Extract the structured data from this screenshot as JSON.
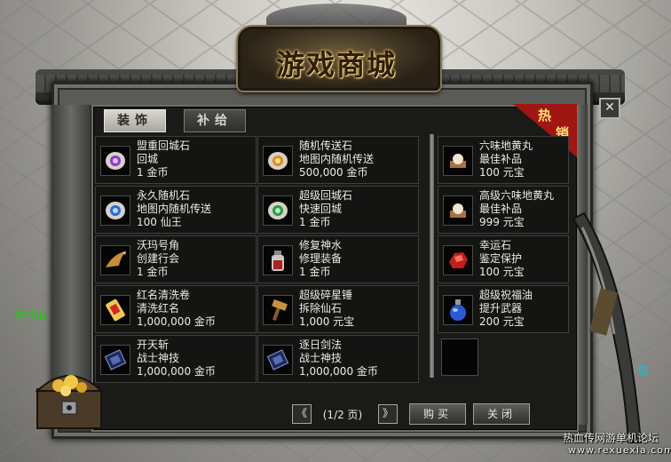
{
  "window": {
    "title": "游戏商城",
    "close_glyph": "✕"
  },
  "tabs": [
    {
      "label": "装饰",
      "active": true
    },
    {
      "label": "补给",
      "active": false
    }
  ],
  "hot_badge": {
    "char1": "热",
    "char2": "销"
  },
  "items_left": [
    {
      "name": "盟重回城石",
      "desc": "回城",
      "price": "1 金币",
      "icon": "purple-scroll-icon"
    },
    {
      "name": "永久随机石",
      "desc": "地图内随机传送",
      "price": "100 仙王",
      "icon": "blue-scroll-icon"
    },
    {
      "name": "沃玛号角",
      "desc": "创建行会",
      "price": "1 金币",
      "icon": "horn-icon"
    },
    {
      "name": "红名清洗卷",
      "desc": "清洗红名",
      "price": "1,000,000 金币",
      "icon": "red-scroll-icon"
    },
    {
      "name": "开天斩",
      "desc": "战士神技",
      "price": "1,000,000 金币",
      "icon": "skill-book-icon"
    }
  ],
  "items_mid": [
    {
      "name": "随机传送石",
      "desc": "地图内随机传送",
      "price": "500,000 金币",
      "icon": "orange-scroll-icon"
    },
    {
      "name": "超级回城石",
      "desc": "快速回城",
      "price": "1 金币",
      "icon": "green-scroll-icon"
    },
    {
      "name": "修复神水",
      "desc": "修理装备",
      "price": "1 金币",
      "icon": "potion-bottle-icon"
    },
    {
      "name": "超级碎星锤",
      "desc": "拆除仙石",
      "price": "1,000 元宝",
      "icon": "hammer-icon"
    },
    {
      "name": "逐日剑法",
      "desc": "战士神技",
      "price": "1,000,000 金币",
      "icon": "skill-book-icon"
    }
  ],
  "items_right": [
    {
      "name": "六味地黄丸",
      "desc": "最佳补品",
      "price": "100 元宝",
      "icon": "pill-box-icon"
    },
    {
      "name": "高级六味地黄丸",
      "desc": "最佳补品",
      "price": "999 元宝",
      "icon": "pill-box-icon"
    },
    {
      "name": "幸运石",
      "desc": "鉴定保护",
      "price": "100 元宝",
      "icon": "red-stone-icon"
    },
    {
      "name": "超级祝福油",
      "desc": "提升武器",
      "price": "200 元宝",
      "icon": "blue-flask-icon"
    }
  ],
  "pager": {
    "prev": "《",
    "label": "(1/2 页)",
    "next": "》"
  },
  "buttons": {
    "buy": "购买",
    "close": "关闭"
  },
  "side": {
    "left_label": "方寸山",
    "right_label": "包"
  },
  "watermark": {
    "line1": "热血传网游单机论坛",
    "line2": "www.rexuexia.com"
  }
}
